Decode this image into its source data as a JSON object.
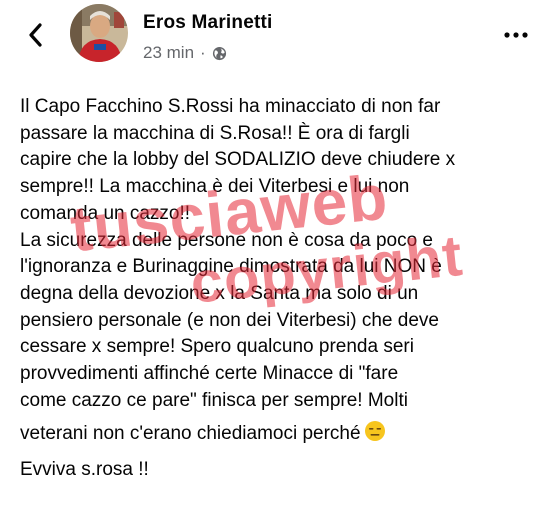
{
  "header": {
    "back_icon": "chevron-left-icon",
    "author_name": "Eros Marinetti",
    "timestamp": "23 min",
    "separator": "·",
    "audience_icon": "globe-icon",
    "more_icon": "more-dots-icon"
  },
  "post": {
    "lines": [
      "Il Capo Facchino S.Rossi ha minacciato di non far",
      "passare la macchina di S.Rosa!! È ora di fargli",
      "capire che la lobby del SODALIZIO deve chiudere x",
      "sempre!! La macchina è dei Viterbesi e lui non",
      "comanda un cazzo!!",
      "La sicurezza delle persone non è cosa da poco e",
      "l'ignoranza e Burinaggine dimostrata da lui NON è",
      "degna della devozione x la Santa ma solo di un",
      "pensiero personale (e non dei Viterbesi) che deve",
      "cessare x sempre! Spero qualcuno prenda seri",
      "provvedimenti affinché certe Minacce di \"fare",
      "come cazzo ce pare\" finisca per sempre! Molti",
      "veterani non c'erano chiediamoci perché",
      "Evviva s.rosa !!"
    ],
    "emoji_icon": "expressionless-face-icon"
  },
  "watermark": {
    "line1": "tusciaweb",
    "line2": "copyright",
    "color": "#e62837"
  },
  "colors": {
    "text": "#050505",
    "secondary": "#65676b"
  }
}
